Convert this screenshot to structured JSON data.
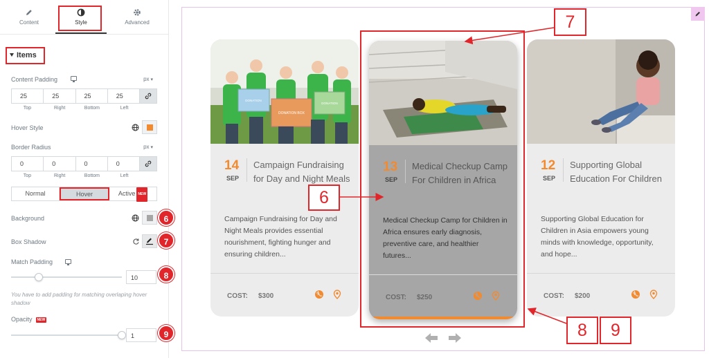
{
  "tabs": {
    "content": "Content",
    "style": "Style",
    "advanced": "Advanced"
  },
  "section": {
    "title": "Items"
  },
  "content_padding": {
    "label": "Content Padding",
    "unit": "px",
    "values": {
      "top": "25",
      "right": "25",
      "bottom": "25",
      "left": "25"
    },
    "side_labels": {
      "top": "Top",
      "right": "Right",
      "bottom": "Bottom",
      "left": "Left"
    }
  },
  "hover_style": {
    "label": "Hover Style"
  },
  "border_radius": {
    "label": "Border Radius",
    "unit": "px",
    "values": {
      "top": "0",
      "right": "0",
      "bottom": "0",
      "left": "0"
    },
    "side_labels": {
      "top": "Top",
      "right": "Right",
      "bottom": "Bottom",
      "left": "Left"
    }
  },
  "state_toggle": {
    "normal": "Normal",
    "hover": "Hover",
    "active": "Active",
    "badge": "NEW",
    "selected": "Hover"
  },
  "background": {
    "label": "Background"
  },
  "box_shadow": {
    "label": "Box Shadow"
  },
  "match_padding": {
    "label": "Match Padding",
    "value": "10",
    "slider_fraction": 0.25,
    "hint": "You have to add padding for matching overlaping hover shadow"
  },
  "opacity": {
    "label": "Opacity",
    "badge": "NEW",
    "value": "1",
    "slider_fraction": 1.0
  },
  "callouts": {
    "n6": "6",
    "n7": "7",
    "n8": "8",
    "n9": "9"
  },
  "cards": [
    {
      "day": "14",
      "month": "SEP",
      "title": "Campaign Fundraising for Day and Night Meals",
      "desc": "Campaign Fundraising for Day and Night Meals provides essential nourishment, fighting hunger and ensuring children...",
      "cost_label": "COST:",
      "cost": "$300"
    },
    {
      "day": "13",
      "month": "SEP",
      "title": "Medical Checkup Camp For Children in Africa",
      "desc": "Medical Checkup Camp for Children in Africa ensures early diagnosis, preventive care, and healthier futures...",
      "cost_label": "COST:",
      "cost": "$250"
    },
    {
      "day": "12",
      "month": "SEP",
      "title": "Supporting Global Education For Children",
      "desc": "Supporting Global Education for Children in Asia empowers young minds with knowledge, opportunity, and hope...",
      "cost_label": "COST:",
      "cost": "$200"
    }
  ],
  "image_signs": {
    "s1": "DONATION",
    "s2": "DONATION BOX",
    "s3": "DONATION"
  },
  "colors": {
    "accent": "#f28a30",
    "callout": "#e0262b",
    "hover_card": "#a6a6a6",
    "card": "#ececec"
  },
  "icons": [
    "pencil-icon",
    "half-circle-icon",
    "gear-icon",
    "link-icon",
    "globe-icon",
    "reset-icon",
    "edit-shadow-icon",
    "monitor-icon",
    "map-pin-icon",
    "arrow-left-icon",
    "arrow-right-icon"
  ]
}
